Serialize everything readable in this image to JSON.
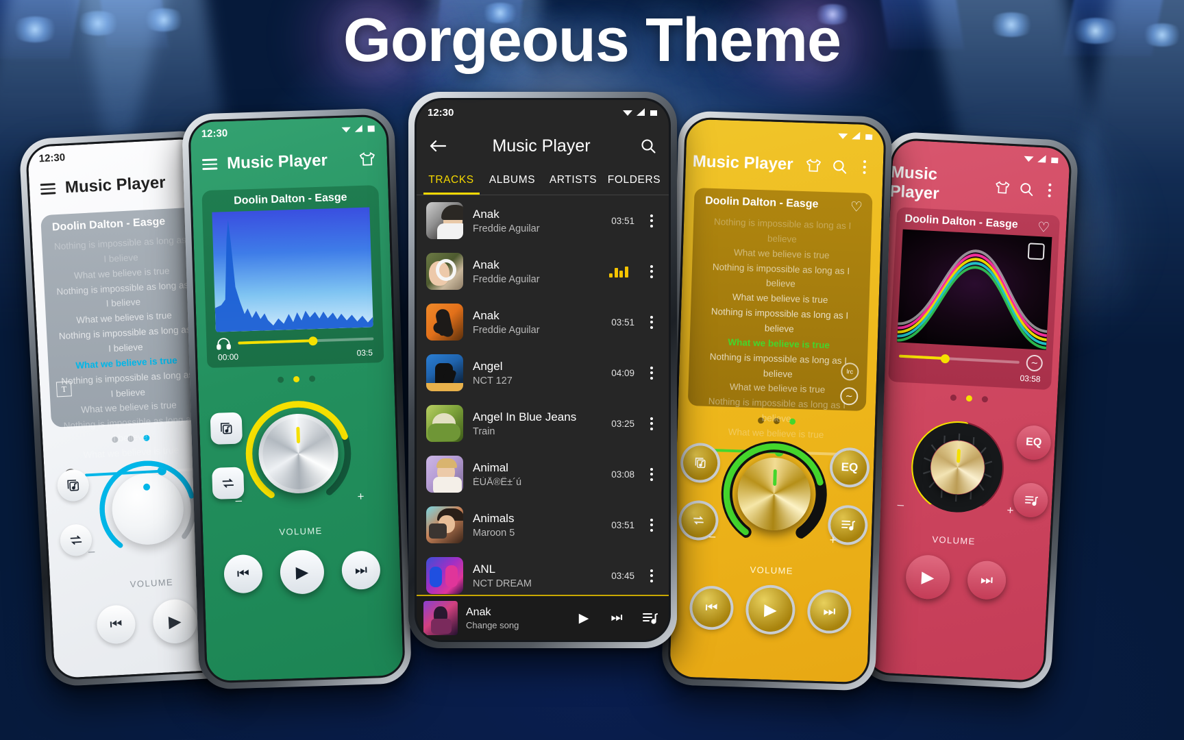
{
  "headline": "Gorgeous Theme",
  "status_time": "12:30",
  "common": {
    "app_title": "Music Player",
    "now_playing_title": "Doolin Dalton - Easge",
    "volume_label": "VOLUME",
    "time_start": "00:00",
    "time_end_green": "03:5",
    "time_end_gold": "03:58",
    "time_end_red": "03:58",
    "minus": "–",
    "plus": "+"
  },
  "lyrics": {
    "lines": [
      "Nothing is impossible as long as I believe",
      "What we believe is true",
      "Nothing is impossible as long as I believe",
      "What we believe is true",
      "Nothing is impossible as long as I believe",
      "What we believe is true",
      "Nothing is impossible as long as I believe",
      "What we believe is true",
      "Nothing is impossible as long as I believe",
      "What we believe is true"
    ],
    "active_index": 5,
    "active_color_white": "#00b6e8",
    "active_color_gold": "#44d62c"
  },
  "phones": {
    "white": {
      "name": "white-theme-phone",
      "accent": "#00b6e8"
    },
    "green": {
      "name": "green-theme-phone",
      "accent": "#f5e000"
    },
    "dark": {
      "name": "dark-theme-phone",
      "accent": "#f5d800"
    },
    "gold": {
      "name": "gold-theme-phone",
      "accent": "#44d62c"
    },
    "red": {
      "name": "red-theme-phone",
      "accent": "#f5e000"
    }
  },
  "center_phone": {
    "title": "Music Player",
    "tabs": [
      {
        "label": "TRACKS",
        "active": true
      },
      {
        "label": "ALBUMS",
        "active": false
      },
      {
        "label": "ARTISTS",
        "active": false
      },
      {
        "label": "FOLDERS",
        "active": false
      }
    ],
    "tracks": [
      {
        "name": "Anak",
        "artist": "Freddie Aguilar",
        "duration": "03:51",
        "playing": false,
        "art": "a1"
      },
      {
        "name": "Anak",
        "artist": "Freddie Aguilar",
        "duration": "",
        "playing": true,
        "art": "a2"
      },
      {
        "name": "Anak",
        "artist": "Freddie Aguilar",
        "duration": "03:51",
        "playing": false,
        "art": "a3"
      },
      {
        "name": "Angel",
        "artist": "NCT 127",
        "duration": "04:09",
        "playing": false,
        "art": "a4"
      },
      {
        "name": "Angel In Blue Jeans",
        "artist": "Train",
        "duration": "03:25",
        "playing": false,
        "art": "a5"
      },
      {
        "name": "Animal",
        "artist": "ÉÙÅ®Ê±´ú",
        "duration": "03:08",
        "playing": false,
        "art": "a6"
      },
      {
        "name": "Animals",
        "artist": "Maroon 5",
        "duration": "03:51",
        "playing": false,
        "art": "a7"
      },
      {
        "name": "ANL",
        "artist": "NCT DREAM",
        "duration": "03:45",
        "playing": false,
        "art": "a8"
      }
    ],
    "mini_player": {
      "name": "Anak",
      "subtitle": "Change song",
      "play_icon": "play-icon",
      "next_icon": "skip-next-icon",
      "queue_icon": "playlist-icon"
    }
  },
  "icons": {
    "menu": "menu-icon",
    "back": "back-arrow-icon",
    "search": "search-icon",
    "theme": "tshirt-icon",
    "overflow": "overflow-menu-icon",
    "headphone": "headphone-icon",
    "playlist": "playlist-icon",
    "repeat": "repeat-icon",
    "prev": "skip-previous-icon",
    "play": "play-icon",
    "next": "skip-next-icon",
    "eq": "EQ",
    "favorite": "heart-icon",
    "lyrics_search": "lrc",
    "wave": "waveform-icon",
    "text": "T",
    "expand": "expand-icon"
  }
}
